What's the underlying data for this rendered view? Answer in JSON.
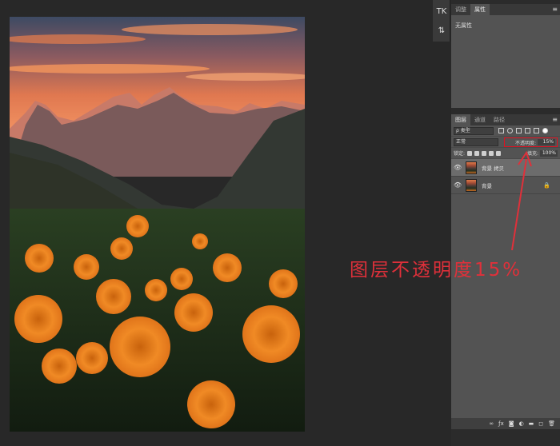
{
  "properties_panel": {
    "tabs": [
      {
        "label": "调整",
        "active": false
      },
      {
        "label": "属性",
        "active": true
      }
    ],
    "content": "无属性"
  },
  "tool_strip": {
    "items": [
      {
        "label": "TK",
        "icon": "tk-plugin-icon"
      },
      {
        "label": "",
        "icon": "adjust-icon"
      }
    ]
  },
  "layers_panel": {
    "tabs": [
      {
        "label": "图层",
        "active": true
      },
      {
        "label": "通道",
        "active": false
      },
      {
        "label": "路径",
        "active": false
      }
    ],
    "filter": "ρ 类型",
    "blend_mode": "正常",
    "opacity_label": "不透明度:",
    "opacity_value": "15%",
    "lock_label": "锁定:",
    "fill_label": "填充:",
    "fill_value": "100%",
    "layers": [
      {
        "name": "背景 拷贝",
        "selected": true,
        "locked": false
      },
      {
        "name": "背景",
        "selected": false,
        "locked": true
      }
    ],
    "footer_icons": [
      "link-icon",
      "fx-icon",
      "mask-icon",
      "adjustment-icon",
      "folder-icon",
      "new-layer-icon",
      "trash-icon"
    ]
  },
  "annotation": {
    "text": "图层不透明度15%",
    "color": "#e0303a"
  },
  "colors": {
    "highlight": "#e01020",
    "panel_bg": "#535353",
    "canvas_bg": "#282828"
  }
}
